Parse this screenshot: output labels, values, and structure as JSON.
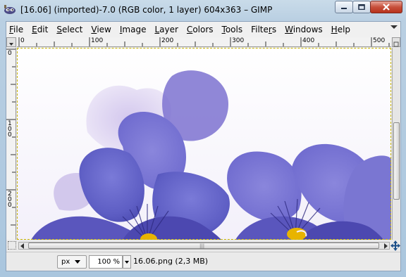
{
  "window": {
    "title": "[16.06] (imported)-7.0 (RGB color, 1 layer) 604x363 – GIMP",
    "minimize_label": "minimize",
    "maximize_label": "maximize",
    "close_label": "close"
  },
  "menubar": {
    "items": [
      {
        "accel": "F",
        "rest": "ile"
      },
      {
        "accel": "E",
        "rest": "dit"
      },
      {
        "accel": "S",
        "rest": "elect"
      },
      {
        "accel": "V",
        "rest": "iew"
      },
      {
        "accel": "I",
        "rest": "mage"
      },
      {
        "accel": "L",
        "rest": "ayer"
      },
      {
        "accel": "C",
        "rest": "olors"
      },
      {
        "accel": "T",
        "rest": "ools"
      },
      {
        "accel": "",
        "rest": "Filte",
        "accel2": "r",
        "rest2": "s"
      },
      {
        "accel": "W",
        "rest": "indows"
      },
      {
        "accel": "H",
        "rest": "elp"
      }
    ]
  },
  "rulers": {
    "horizontal": [
      "0",
      "100",
      "200",
      "300",
      "400",
      "500"
    ],
    "vertical": [
      "0",
      "100",
      "200"
    ]
  },
  "statusbar": {
    "unit": "px",
    "zoom": "100 %",
    "file_info": "16.06.png (2,3 MB)"
  },
  "colors": {
    "title_gradient_top": "#c9dbe9",
    "close_button": "#c7503b",
    "flower_violet": "#6f6fcf",
    "flower_center": "#e8b400"
  },
  "icons": {
    "app": "gimp-wilber-icon",
    "corner": "quick-mask-icon",
    "navigate": "navigate-move-icon"
  },
  "canvas": {
    "image_name": "16.06.png"
  }
}
